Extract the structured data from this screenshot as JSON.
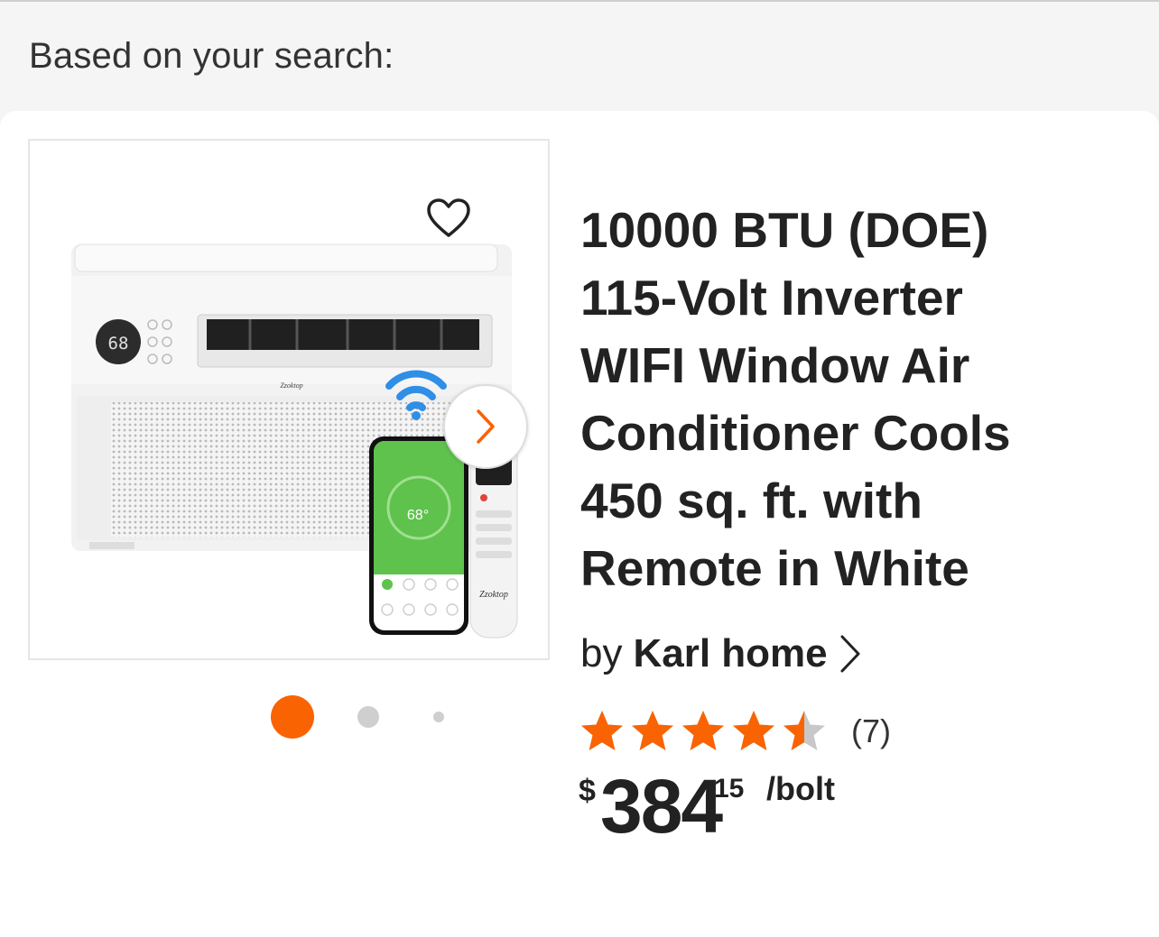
{
  "header": {
    "search_heading": "Based on your search:"
  },
  "product": {
    "title_lines": [
      "10000 BTU (DOE)",
      "115-Volt Inverter",
      "WIFI Window Air",
      "Conditioner Cools",
      "450 sq. ft. with",
      "Remote in White"
    ],
    "brand_prefix": "by",
    "brand_name": "Karl home",
    "rating": 4.5,
    "rating_max": 5,
    "review_count": "(7)",
    "price": {
      "currency": "$",
      "dollars": "384",
      "cents": "15",
      "unit": "/bolt"
    },
    "image": {
      "display_temp": "68",
      "phone_temp": "68°",
      "remote_brand": "Zzoktop",
      "unit_brand": "Zzoktop",
      "carousel_index": 1,
      "carousel_count": 3
    }
  },
  "colors": {
    "accent": "#f96302",
    "star_empty": "#c8c8c8",
    "wifi": "#2f8ee6",
    "phone_green": "#5ec24d"
  },
  "icons": {
    "favorite": "heart-outline-icon",
    "next": "chevron-right-icon",
    "brand_link": "chevron-right-icon"
  }
}
